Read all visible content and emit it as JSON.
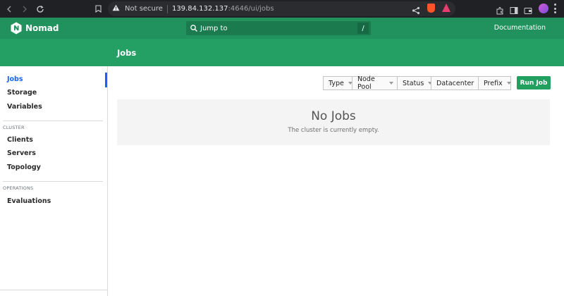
{
  "browser": {
    "security": "Not secure",
    "host": "139.84.132.137",
    "path": ":4646/ui/jobs"
  },
  "header": {
    "brand": "Nomad",
    "search_placeholder": "Jump to",
    "search_shortcut": "/",
    "documentation": "Documentation"
  },
  "page": {
    "title": "Jobs"
  },
  "sidebar": {
    "items": [
      {
        "label": "Jobs",
        "active": true
      },
      {
        "label": "Storage"
      },
      {
        "label": "Variables"
      }
    ],
    "cluster_heading": "CLUSTER",
    "cluster_items": [
      {
        "label": "Clients"
      },
      {
        "label": "Servers"
      },
      {
        "label": "Topology"
      }
    ],
    "operations_heading": "OPERATIONS",
    "operations_items": [
      {
        "label": "Evaluations"
      }
    ]
  },
  "toolbar": {
    "filters": [
      {
        "label": "Type"
      },
      {
        "label": "Node Pool"
      },
      {
        "label": "Status"
      },
      {
        "label": "Datacenter"
      },
      {
        "label": "Prefix"
      }
    ],
    "run_job": "Run Job"
  },
  "empty_state": {
    "title": "No Jobs",
    "message": "The cluster is currently empty."
  },
  "colors": {
    "header": "#21925e",
    "page_band": "#25a065",
    "accent_blue": "#1563ff",
    "run_button": "#21a060"
  }
}
